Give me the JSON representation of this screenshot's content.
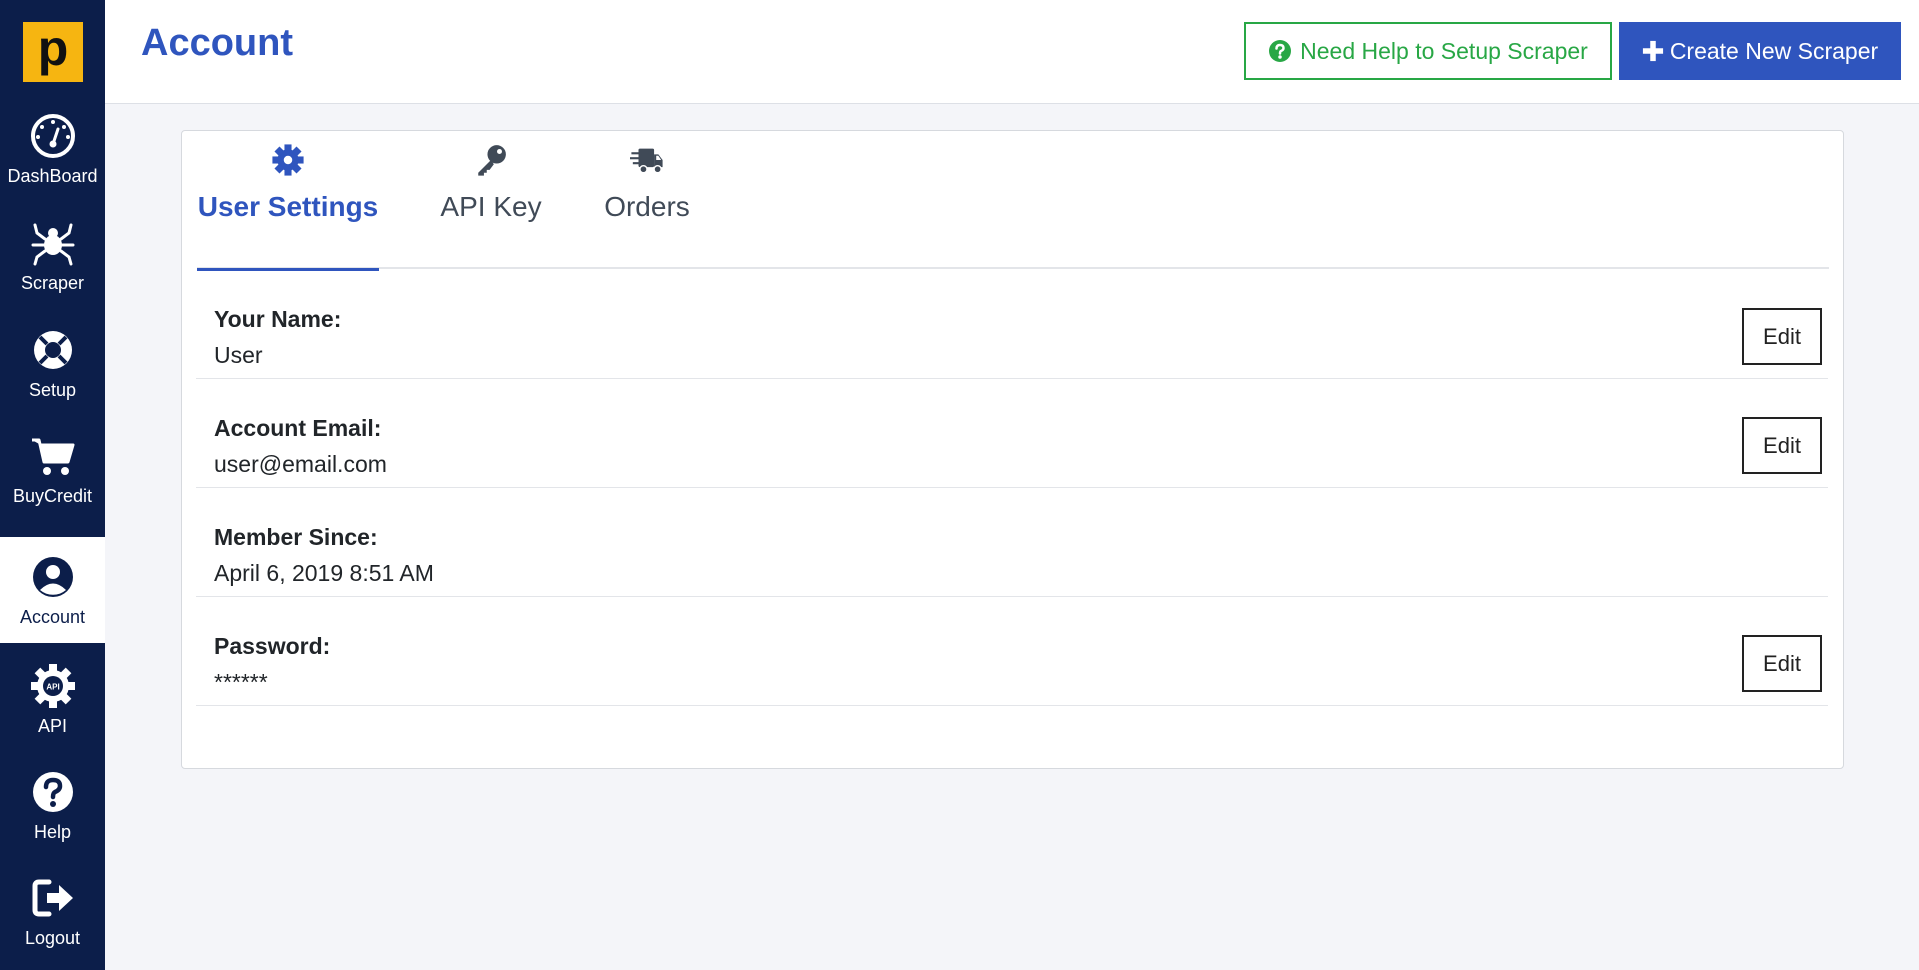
{
  "sidebar": {
    "logo": "p",
    "items": [
      {
        "label": "DashBoard",
        "icon": "dashboard-gauge-icon"
      },
      {
        "label": "Scraper",
        "icon": "spider-icon"
      },
      {
        "label": "Setup",
        "icon": "lifebuoy-icon"
      },
      {
        "label": "BuyCredit",
        "icon": "cart-icon"
      },
      {
        "label": "Account",
        "icon": "user-circle-icon",
        "active": true
      },
      {
        "label": "API",
        "icon": "api-gear-icon"
      },
      {
        "label": "Help",
        "icon": "question-circle-icon"
      },
      {
        "label": "Logout",
        "icon": "logout-icon"
      }
    ]
  },
  "header": {
    "title": "Account",
    "help_button": "Need Help to Setup Scraper",
    "create_button": "Create New Scraper"
  },
  "tabs": [
    {
      "label": "User Settings",
      "icon": "gear-icon",
      "active": true
    },
    {
      "label": "API Key",
      "icon": "key-icon"
    },
    {
      "label": "Orders",
      "icon": "truck-icon"
    }
  ],
  "fields": [
    {
      "label": "Your Name:",
      "value": "User",
      "edit": "Edit"
    },
    {
      "label": "Account Email:",
      "value": "user@email.com",
      "edit": "Edit"
    },
    {
      "label": "Member Since:",
      "value": "April 6, 2019 8:51 AM"
    },
    {
      "label": "Password:",
      "value": "******",
      "edit": "Edit"
    }
  ],
  "colors": {
    "sidebar": "#0c1e4a",
    "brand": "#2f55be",
    "logo": "#f6b511",
    "help": "#28a745"
  }
}
